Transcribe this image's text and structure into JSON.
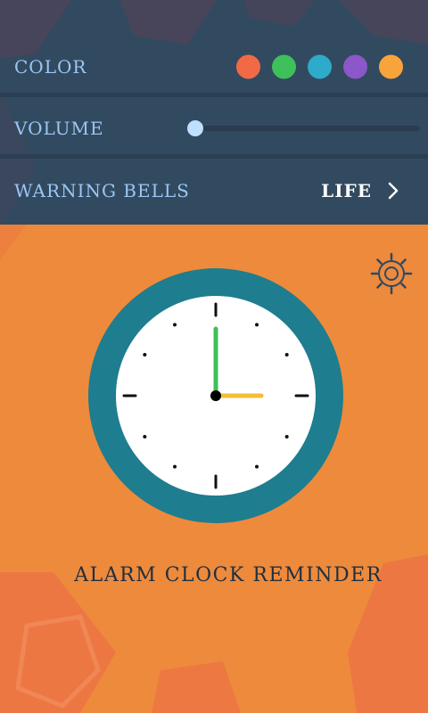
{
  "settings": {
    "color": {
      "label": "COLOR",
      "swatches": [
        {
          "name": "red-orange",
          "color": "#f26a45"
        },
        {
          "name": "green",
          "color": "#3ec15a"
        },
        {
          "name": "teal",
          "color": "#2eaacb"
        },
        {
          "name": "purple",
          "color": "#8b57c9"
        },
        {
          "name": "orange",
          "color": "#f9a43a"
        }
      ]
    },
    "volume": {
      "label": "VOLUME",
      "value_fraction": 0.0
    },
    "warning_bells": {
      "label": "WARNING BELLS",
      "value": "LIFE",
      "icon": "chevron-right-icon"
    }
  },
  "main": {
    "settings_icon": "gear-icon",
    "clock": {
      "hours": 3,
      "minutes": 0
    },
    "title": "ALARM CLOCK REMINDER"
  },
  "colors": {
    "header_bg": "#324a5f",
    "main_bg": "#ee8a3c",
    "clock_ring": "#1e7d8e",
    "clock_face": "#ffffff",
    "hour_hand": "#f4bd32",
    "minute_hand": "#3fbf57"
  }
}
